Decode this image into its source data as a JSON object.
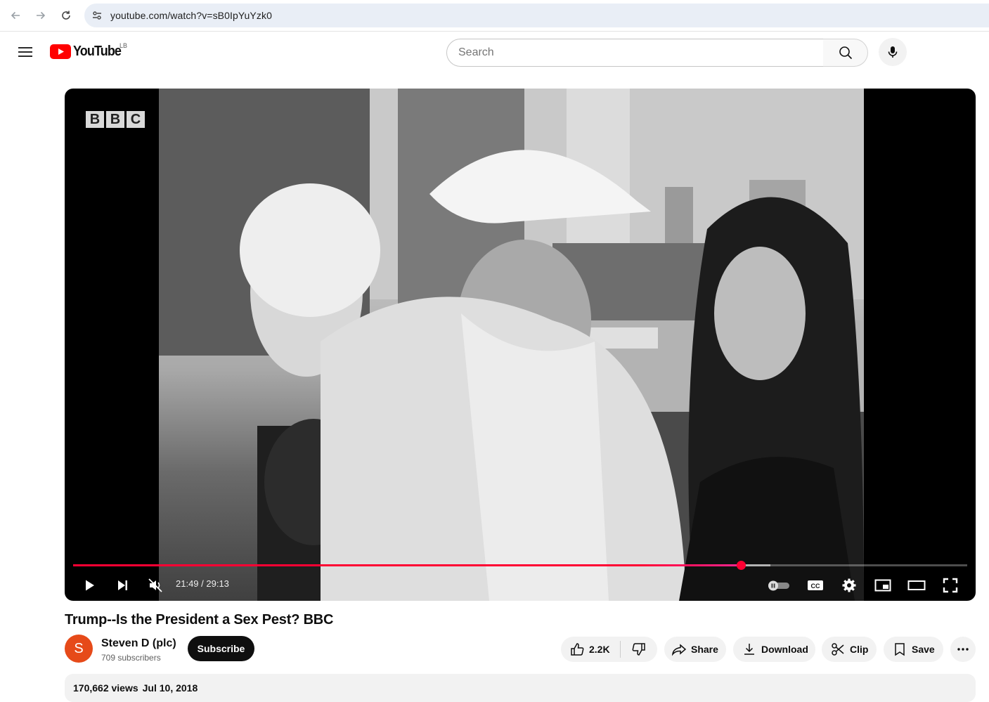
{
  "browser": {
    "url": "youtube.com/watch?v=sB0IpYuYzk0"
  },
  "header": {
    "logo_text": "YouTube",
    "country_code": "LB",
    "search_placeholder": "Search"
  },
  "player": {
    "watermark": [
      "B",
      "B",
      "C"
    ],
    "current_time": "21:49",
    "duration": "29:13",
    "time_display": "21:49 / 29:13",
    "progress_fraction": 0.747,
    "buffered_fraction": 0.78,
    "muted": true,
    "autoplay_on": false,
    "accent": "#ff0033"
  },
  "video": {
    "title": "Trump--Is the President a Sex Pest? BBC",
    "channel_name": "Steven D (plc)",
    "channel_initial": "S",
    "subscribers": "709 subscribers",
    "subscribe_label": "Subscribe",
    "likes": "2.2K",
    "share_label": "Share",
    "download_label": "Download",
    "clip_label": "Clip",
    "save_label": "Save",
    "views": "170,662 views",
    "date": "Jul 10, 2018"
  },
  "colors": {
    "avatar_bg": "#e64a19",
    "subscribe_bg": "#0f0f0f",
    "pill_bg": "#f2f2f2"
  }
}
